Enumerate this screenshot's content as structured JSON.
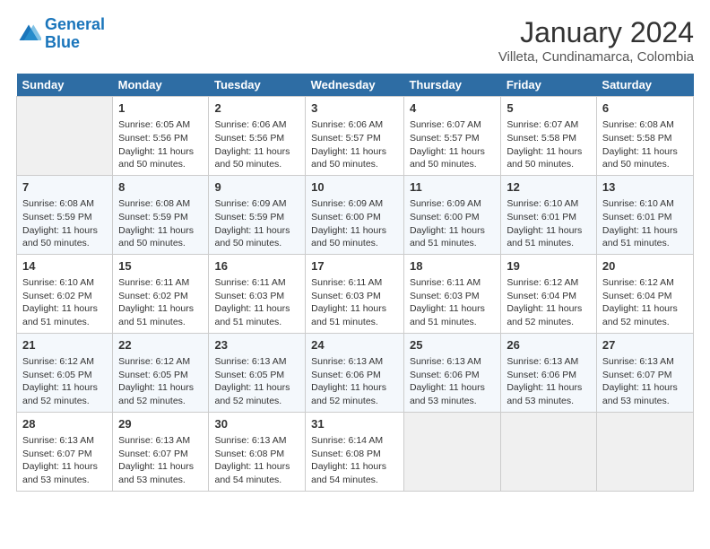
{
  "logo": {
    "line1": "General",
    "line2": "Blue"
  },
  "title": "January 2024",
  "subtitle": "Villeta, Cundinamarca, Colombia",
  "weekdays": [
    "Sunday",
    "Monday",
    "Tuesday",
    "Wednesday",
    "Thursday",
    "Friday",
    "Saturday"
  ],
  "weeks": [
    [
      {
        "day": "",
        "text": ""
      },
      {
        "day": "1",
        "text": "Sunrise: 6:05 AM\nSunset: 5:56 PM\nDaylight: 11 hours\nand 50 minutes."
      },
      {
        "day": "2",
        "text": "Sunrise: 6:06 AM\nSunset: 5:56 PM\nDaylight: 11 hours\nand 50 minutes."
      },
      {
        "day": "3",
        "text": "Sunrise: 6:06 AM\nSunset: 5:57 PM\nDaylight: 11 hours\nand 50 minutes."
      },
      {
        "day": "4",
        "text": "Sunrise: 6:07 AM\nSunset: 5:57 PM\nDaylight: 11 hours\nand 50 minutes."
      },
      {
        "day": "5",
        "text": "Sunrise: 6:07 AM\nSunset: 5:58 PM\nDaylight: 11 hours\nand 50 minutes."
      },
      {
        "day": "6",
        "text": "Sunrise: 6:08 AM\nSunset: 5:58 PM\nDaylight: 11 hours\nand 50 minutes."
      }
    ],
    [
      {
        "day": "7",
        "text": "Sunrise: 6:08 AM\nSunset: 5:59 PM\nDaylight: 11 hours\nand 50 minutes."
      },
      {
        "day": "8",
        "text": "Sunrise: 6:08 AM\nSunset: 5:59 PM\nDaylight: 11 hours\nand 50 minutes."
      },
      {
        "day": "9",
        "text": "Sunrise: 6:09 AM\nSunset: 5:59 PM\nDaylight: 11 hours\nand 50 minutes."
      },
      {
        "day": "10",
        "text": "Sunrise: 6:09 AM\nSunset: 6:00 PM\nDaylight: 11 hours\nand 50 minutes."
      },
      {
        "day": "11",
        "text": "Sunrise: 6:09 AM\nSunset: 6:00 PM\nDaylight: 11 hours\nand 51 minutes."
      },
      {
        "day": "12",
        "text": "Sunrise: 6:10 AM\nSunset: 6:01 PM\nDaylight: 11 hours\nand 51 minutes."
      },
      {
        "day": "13",
        "text": "Sunrise: 6:10 AM\nSunset: 6:01 PM\nDaylight: 11 hours\nand 51 minutes."
      }
    ],
    [
      {
        "day": "14",
        "text": "Sunrise: 6:10 AM\nSunset: 6:02 PM\nDaylight: 11 hours\nand 51 minutes."
      },
      {
        "day": "15",
        "text": "Sunrise: 6:11 AM\nSunset: 6:02 PM\nDaylight: 11 hours\nand 51 minutes."
      },
      {
        "day": "16",
        "text": "Sunrise: 6:11 AM\nSunset: 6:03 PM\nDaylight: 11 hours\nand 51 minutes."
      },
      {
        "day": "17",
        "text": "Sunrise: 6:11 AM\nSunset: 6:03 PM\nDaylight: 11 hours\nand 51 minutes."
      },
      {
        "day": "18",
        "text": "Sunrise: 6:11 AM\nSunset: 6:03 PM\nDaylight: 11 hours\nand 51 minutes."
      },
      {
        "day": "19",
        "text": "Sunrise: 6:12 AM\nSunset: 6:04 PM\nDaylight: 11 hours\nand 52 minutes."
      },
      {
        "day": "20",
        "text": "Sunrise: 6:12 AM\nSunset: 6:04 PM\nDaylight: 11 hours\nand 52 minutes."
      }
    ],
    [
      {
        "day": "21",
        "text": "Sunrise: 6:12 AM\nSunset: 6:05 PM\nDaylight: 11 hours\nand 52 minutes."
      },
      {
        "day": "22",
        "text": "Sunrise: 6:12 AM\nSunset: 6:05 PM\nDaylight: 11 hours\nand 52 minutes."
      },
      {
        "day": "23",
        "text": "Sunrise: 6:13 AM\nSunset: 6:05 PM\nDaylight: 11 hours\nand 52 minutes."
      },
      {
        "day": "24",
        "text": "Sunrise: 6:13 AM\nSunset: 6:06 PM\nDaylight: 11 hours\nand 52 minutes."
      },
      {
        "day": "25",
        "text": "Sunrise: 6:13 AM\nSunset: 6:06 PM\nDaylight: 11 hours\nand 53 minutes."
      },
      {
        "day": "26",
        "text": "Sunrise: 6:13 AM\nSunset: 6:06 PM\nDaylight: 11 hours\nand 53 minutes."
      },
      {
        "day": "27",
        "text": "Sunrise: 6:13 AM\nSunset: 6:07 PM\nDaylight: 11 hours\nand 53 minutes."
      }
    ],
    [
      {
        "day": "28",
        "text": "Sunrise: 6:13 AM\nSunset: 6:07 PM\nDaylight: 11 hours\nand 53 minutes."
      },
      {
        "day": "29",
        "text": "Sunrise: 6:13 AM\nSunset: 6:07 PM\nDaylight: 11 hours\nand 53 minutes."
      },
      {
        "day": "30",
        "text": "Sunrise: 6:13 AM\nSunset: 6:08 PM\nDaylight: 11 hours\nand 54 minutes."
      },
      {
        "day": "31",
        "text": "Sunrise: 6:14 AM\nSunset: 6:08 PM\nDaylight: 11 hours\nand 54 minutes."
      },
      {
        "day": "",
        "text": ""
      },
      {
        "day": "",
        "text": ""
      },
      {
        "day": "",
        "text": ""
      }
    ]
  ]
}
